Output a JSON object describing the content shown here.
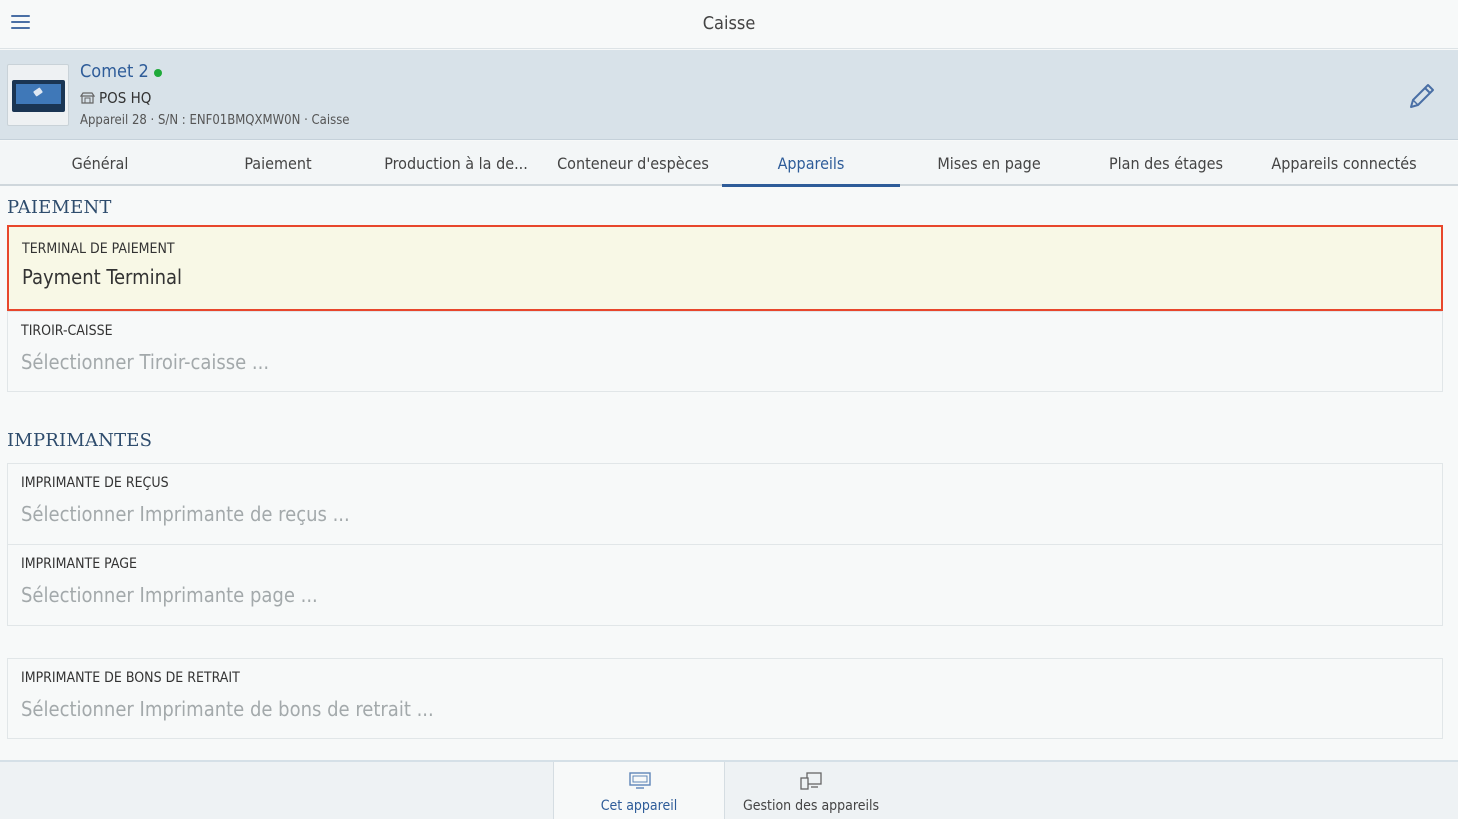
{
  "app": {
    "title": "Caisse"
  },
  "device": {
    "name": "Comet 2",
    "store": "POS HQ",
    "meta": "Appareil 28 · S/N : ENF01BMQXMW0N · Caisse",
    "status_color": "#1faa3a"
  },
  "tabs": [
    {
      "label": "Général"
    },
    {
      "label": "Paiement"
    },
    {
      "label": "Production à la de..."
    },
    {
      "label": "Conteneur d'espèces"
    },
    {
      "label": "Appareils",
      "active": true
    },
    {
      "label": "Mises en page"
    },
    {
      "label": "Plan des étages"
    },
    {
      "label": "Appareils connectés"
    }
  ],
  "sections": {
    "payment": {
      "title": "PAIEMENT",
      "terminal": {
        "label": "TERMINAL DE PAIEMENT",
        "value": "Payment Terminal"
      },
      "drawer": {
        "label": "TIROIR-CAISSE",
        "placeholder": "Sélectionner Tiroir-caisse ..."
      }
    },
    "printers": {
      "title": "IMPRIMANTES",
      "receipt": {
        "label": "IMPRIMANTE DE REÇUS",
        "placeholder": "Sélectionner Imprimante de reçus ..."
      },
      "page": {
        "label": "IMPRIMANTE PAGE",
        "placeholder": "Sélectionner Imprimante page ..."
      },
      "pickup": {
        "label": "IMPRIMANTE DE BONS DE RETRAIT",
        "placeholder": "Sélectionner Imprimante de bons de retrait ..."
      }
    }
  },
  "bottom_nav": {
    "this_device": {
      "label": "Cet appareil",
      "icon": "monitor-icon"
    },
    "device_management": {
      "label": "Gestion des appareils",
      "icon": "devices-icon"
    }
  },
  "colors": {
    "accent": "#2e5c99",
    "selection_border": "#e8472c",
    "selection_bg": "#f8f8e6"
  }
}
